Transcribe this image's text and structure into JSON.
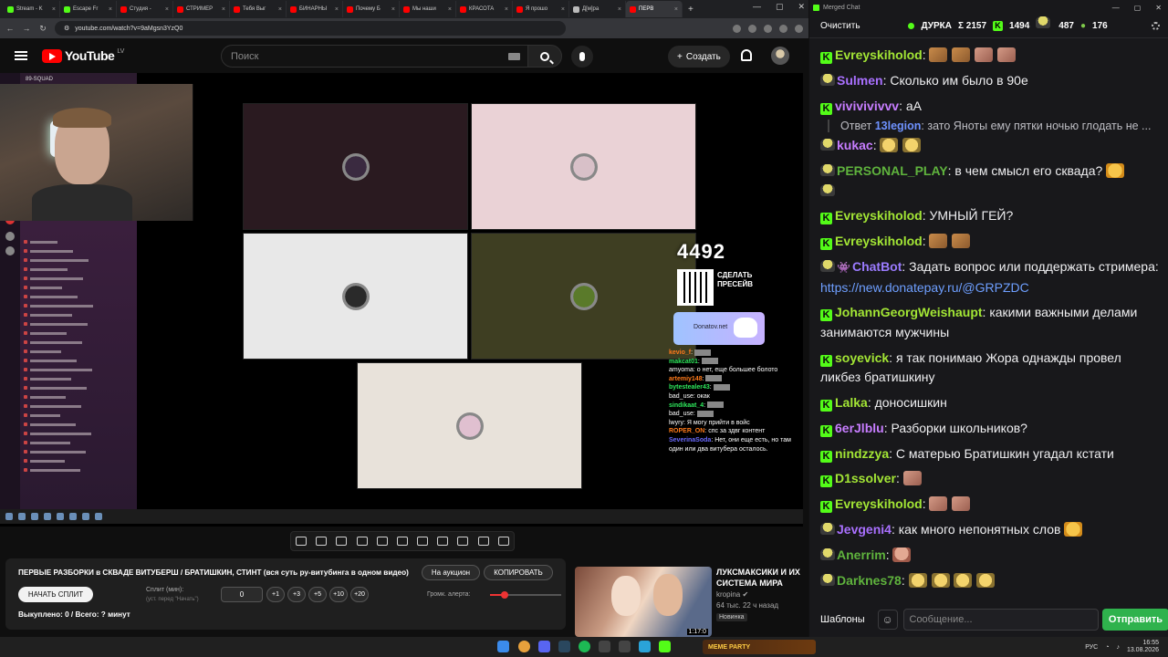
{
  "browser": {
    "tabs": [
      {
        "label": "Stream - K",
        "color": "#53fc18"
      },
      {
        "label": "Escape Fr",
        "color": "#53fc18"
      },
      {
        "label": "Студия -",
        "color": "#ff0000"
      },
      {
        "label": "СТРИМЕР",
        "color": "#ff0000"
      },
      {
        "label": "Тебя Выг",
        "color": "#ff0000"
      },
      {
        "label": "БИНАРНЫ",
        "color": "#ff0000"
      },
      {
        "label": "Почему Б",
        "color": "#ff0000"
      },
      {
        "label": "Мы наши",
        "color": "#ff0000"
      },
      {
        "label": "КРАСОТА",
        "color": "#ff0000"
      },
      {
        "label": "Я прошо",
        "color": "#ff0000"
      },
      {
        "label": "Д[м]ра",
        "color": "#bbbbbb"
      },
      {
        "label": "ПЕРВ",
        "color": "#ff0000",
        "active": true
      }
    ],
    "url": "youtube.com/watch?v=9aMgsn3YzQ0"
  },
  "youtube": {
    "logo_text": "YouTube",
    "region": "LV",
    "search_placeholder": "Поиск",
    "create_label": "Создать"
  },
  "player": {
    "server_name": "89-SQUAD",
    "donate_counter": "4492",
    "qr_caption": "СДЕЛАТЬ ПРЕСЕЙВ",
    "donatov_label": "Donatov.net",
    "tile_colors": [
      "#2a1a20",
      "#ead2d6",
      "#e8e8e8",
      "#3e3e22",
      "#e8e2da"
    ],
    "stream_chat": [
      {
        "user": "kevio_f",
        "text": "",
        "cls": "n1"
      },
      {
        "user": "makcat01",
        "text": "",
        "cls": "n2"
      },
      {
        "user": "amyoma",
        "text": "о нет, еще большее болото",
        "cls": ""
      },
      {
        "user": "artemiy148",
        "text": "",
        "cls": "n1"
      },
      {
        "user": "bytestealer43",
        "text": "",
        "cls": "n2"
      },
      {
        "user": "bad_use",
        "text": "окак",
        "cls": ""
      },
      {
        "user": "sindikaat_4",
        "text": "",
        "cls": "n2"
      },
      {
        "user": "bad_use",
        "text": "",
        "cls": ""
      },
      {
        "user": "lwyry",
        "text": "Я могу прийти в войс",
        "cls": ""
      },
      {
        "user": "ROPER_ON",
        "text": "спс за здвг контент",
        "cls": "n1"
      },
      {
        "user": "SeverinaSoda",
        "text": "Нет, они еще есть, но там один или два витубера осталось.",
        "cls": "n3"
      }
    ]
  },
  "panel": {
    "title": "ПЕРВЫЕ РАЗБОРКИ в СКВАДЕ ВИТУБЕРШ / БРАТИШКИН, СТИНТ (вся суть ру-витубинга в одном видео)",
    "auction_label": "На аукцион",
    "copy_label": "КОПИРОВАТЬ",
    "start_split_label": "НАЧАТЬ СПЛИТ",
    "split_label": "Сплит (мин):",
    "split_hint": "(уст. перед \"Начать\")",
    "split_value": "0",
    "increments": [
      "+1",
      "+3",
      "+5",
      "+10",
      "+20"
    ],
    "alert_volume_label": "Громк. алерта:",
    "alert_volume": 0.2,
    "bought_label": "Выкуплено: 0 / Всего: ? минут"
  },
  "recommended": {
    "title": "ЛУКСМАКСИКИ И ИХ СИСТЕМА МИРА",
    "channel": "kropina",
    "meta": "64 тыс.  22 ч назад",
    "badge": "Новинка",
    "duration": "1:17:0"
  },
  "taskbar": {
    "media_title": "MEME PARTY",
    "language": "РУС",
    "time": "16:55",
    "date": "13.08.2026"
  },
  "chat": {
    "window_title": "Merged Chat",
    "clear_label": "Очистить",
    "channel": "ДУРКА",
    "stats": {
      "total": "Σ 2157",
      "kick": "1494",
      "twitch": "487",
      "other": "176"
    },
    "messages": [
      {
        "platform": "kick",
        "user": "Evreyskiholod",
        "color": "#a3e635",
        "text": "",
        "emotes": [
          "em-cat",
          "em-cat",
          "em-face",
          "em-face"
        ]
      },
      {
        "platform": "twitch",
        "user": "Sulmen",
        "color": "#a970ff",
        "text": "Сколько им было в 90е",
        "emotes": []
      },
      {
        "platform": "kick",
        "user": "vivivivivvv",
        "color": "#c77dff",
        "text": "аА",
        "emotes": []
      },
      {
        "type": "reply",
        "prefix": "Ответ",
        "user": "13legion",
        "text": ": зато Яноты ему пятки ночью глодать не ..."
      },
      {
        "platform": "twitch",
        "user": "kukac",
        "color": "#c77dff",
        "text": "",
        "emotes": [
          "em-laugh",
          "em-laugh"
        ]
      },
      {
        "platform": "twitch",
        "user": "PERSONAL_PLAY",
        "color": "#5fb33d",
        "text": "в чем смысл его сквада?",
        "emotes": [
          "em-smile"
        ],
        "tail": true
      },
      {
        "platform": "kick",
        "user": "Evreyskiholod",
        "color": "#a3e635",
        "text": "УМНЫЙ ГЕЙ?",
        "emotes": []
      },
      {
        "platform": "kick",
        "user": "Evreyskiholod",
        "color": "#a3e635",
        "text": "",
        "emotes": [
          "em-cat",
          "em-cat"
        ]
      },
      {
        "platform": "twitch",
        "user": "ChatBot",
        "color": "#9b7bff",
        "text": "Задать вопрос или поддержать стримера: ",
        "link": "https://new.donatepay.ru/@GRPZDC",
        "emotes": [],
        "bot": true
      },
      {
        "platform": "kick",
        "user": "JohannGeorgWeishaupt",
        "color": "#a3e635",
        "text": "какими важными делами занимаются мужчины",
        "emotes": []
      },
      {
        "platform": "kick",
        "user": "soyevick",
        "color": "#a3e635",
        "text": "я так понимаю Жора однажды провел ликбез братишкину",
        "emotes": []
      },
      {
        "platform": "kick",
        "user": "Lalka",
        "color": "#a3e635",
        "text": "доносишкин",
        "emotes": []
      },
      {
        "platform": "kick",
        "user": "6erJlblu",
        "color": "#c77dff",
        "text": "Разборки школьников?",
        "emotes": []
      },
      {
        "platform": "kick",
        "user": "nindzzya",
        "color": "#a3e635",
        "text": "С матерью Братишкин угадал кстати",
        "emotes": []
      },
      {
        "platform": "kick",
        "user": "D1ssolver",
        "color": "#a3e635",
        "text": "",
        "emotes": [
          "em-face"
        ]
      },
      {
        "platform": "kick",
        "user": "Evreyskiholod",
        "color": "#a3e635",
        "text": "",
        "emotes": [
          "em-face",
          "em-face"
        ]
      },
      {
        "platform": "twitch",
        "user": "Jevgeni4",
        "color": "#a970ff",
        "text": "как много непонятных слов",
        "emotes": [
          "em-smile"
        ]
      },
      {
        "platform": "twitch",
        "user": "Anerrim",
        "color": "#5fb33d",
        "text": "",
        "emotes": [
          "em-bald"
        ]
      },
      {
        "platform": "twitch",
        "user": "Darknes78",
        "color": "#5fb33d",
        "text": "",
        "emotes": [
          "em-laugh",
          "em-laugh",
          "em-laugh",
          "em-laugh"
        ]
      }
    ],
    "footer": {
      "templates_label": "Шаблоны",
      "input_placeholder": "Сообщение...",
      "send_label": "Отправить"
    }
  }
}
